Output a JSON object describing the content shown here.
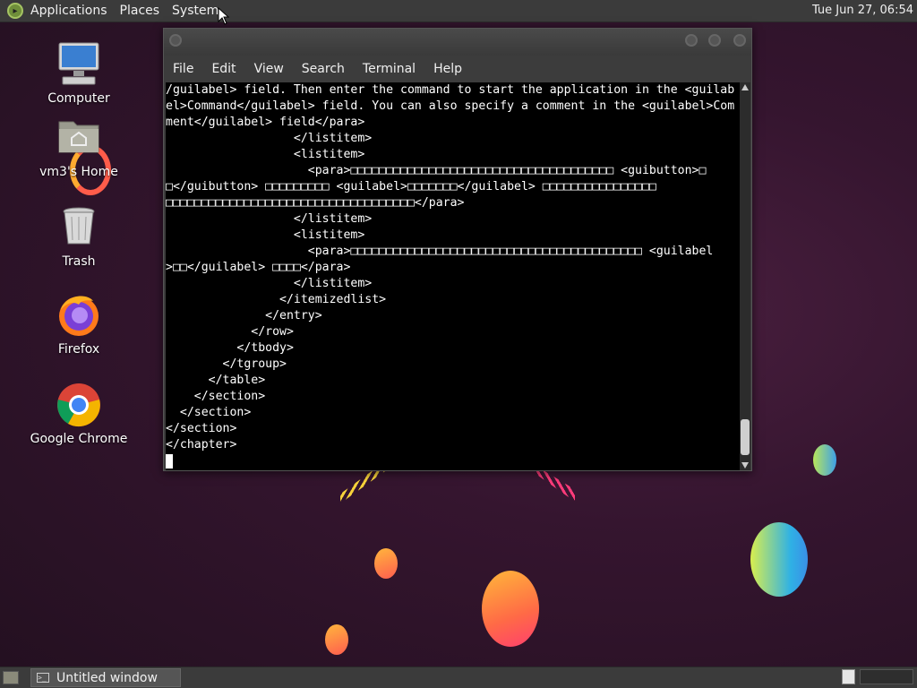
{
  "top_panel": {
    "menus": [
      "Applications",
      "Places",
      "System"
    ],
    "clock": "Tue Jun 27, 06:54"
  },
  "desktop_icons": [
    {
      "label": "Computer",
      "icon": "computer-icon"
    },
    {
      "label": "vm3's Home",
      "icon": "home-folder-icon"
    },
    {
      "label": "Trash",
      "icon": "trash-icon"
    },
    {
      "label": "Firefox",
      "icon": "firefox-icon"
    },
    {
      "label": "Google Chrome",
      "icon": "chrome-icon"
    }
  ],
  "terminal": {
    "menus": [
      "File",
      "Edit",
      "View",
      "Search",
      "Terminal",
      "Help"
    ],
    "lines": [
      "/guilabel> field. Then enter the command to start the application in the <guilab",
      "el>Command</guilabel> field. You can also specify a comment in the <guilabel>Com",
      "ment</guilabel> field</para>",
      "                  </listitem>",
      "                  <listitem>",
      "                    <para>□□□□□□□□□□□□□□□□□□□□□□□□□□□□□□□□□□□□□ <guibutton>□",
      "□</guibutton> □□□□□□□□□ <guilabel>□□□□□□□</guilabel> □□□□□□□□□□□□□□□□",
      "□□□□□□□□□□□□□□□□□□□□□□□□□□□□□□□□□□□</para>",
      "                  </listitem>",
      "                  <listitem>",
      "                    <para>□□□□□□□□□□□□□□□□□□□□□□□□□□□□□□□□□□□□□□□□□ <guilabel",
      ">□□</guilabel> □□□□</para>",
      "                  </listitem>",
      "                </itemizedlist>",
      "              </entry>",
      "            </row>",
      "          </tbody>",
      "        </tgroup>",
      "      </table>",
      "    </section>",
      "  </section>",
      "</section>",
      "</chapter>"
    ]
  },
  "taskbar": {
    "window_title": "Untitled window"
  }
}
